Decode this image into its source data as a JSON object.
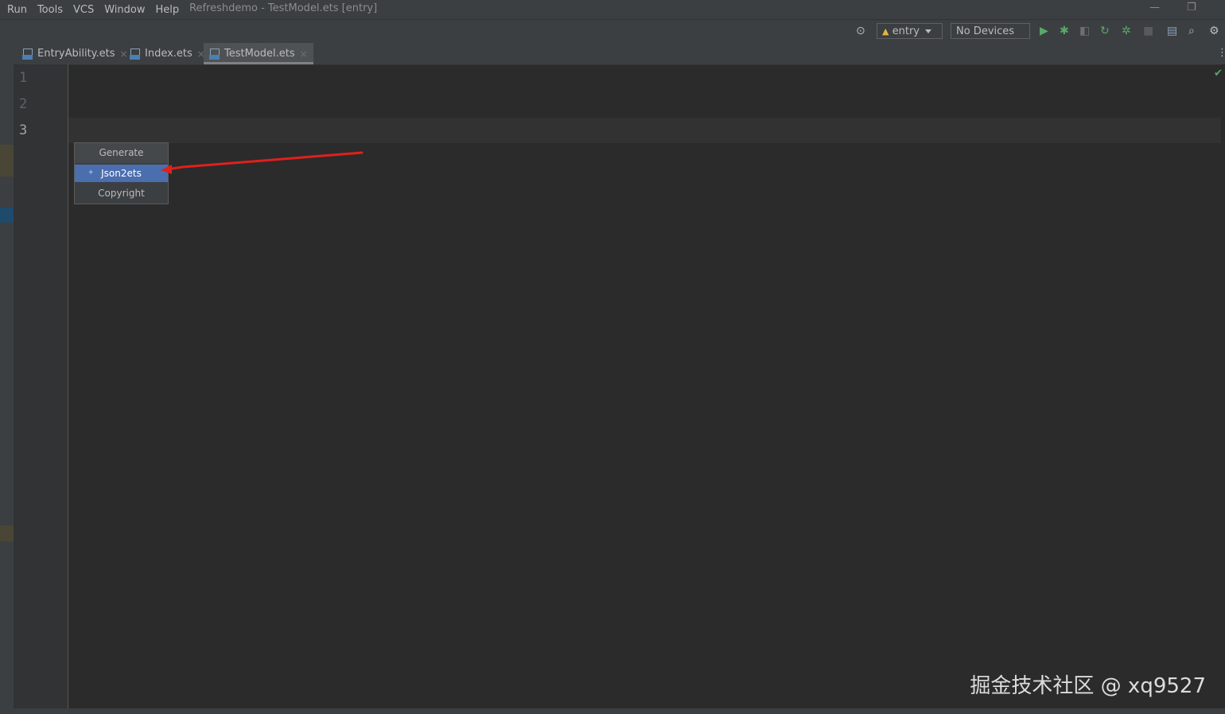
{
  "menubar": {
    "items": [
      "Run",
      "Tools",
      "VCS",
      "Window",
      "Help"
    ],
    "window_title": "Refreshdemo - TestModel.ets [entry]"
  },
  "toolbar": {
    "module_combo": "entry",
    "device_combo": "No Devices"
  },
  "tabs": [
    {
      "label": "EntryAbility.ets",
      "active": false
    },
    {
      "label": "Index.ets",
      "active": false
    },
    {
      "label": "TestModel.ets",
      "active": true
    }
  ],
  "editor": {
    "line_numbers": [
      "1",
      "2",
      "3"
    ],
    "current_line": 3
  },
  "popup": {
    "title": "Generate",
    "items": [
      {
        "label": "Json2ets",
        "selected": true
      },
      {
        "label": "Copyright",
        "selected": false
      }
    ]
  },
  "watermark": "掘金技术社区 @ xq9527",
  "colors": {
    "accent_selection": "#4b6eaf",
    "annotation_arrow": "#e0201c",
    "run_green": "#59a869"
  }
}
